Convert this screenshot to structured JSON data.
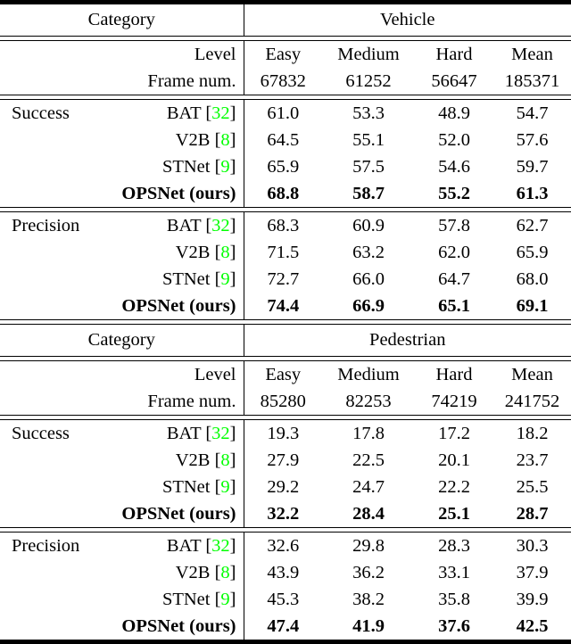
{
  "table": {
    "caption_colors": {
      "citation_green": "#00FF00",
      "text": "#000000"
    },
    "column_divider": "|",
    "sections": [
      {
        "id": "vehicle",
        "category_label": "Category",
        "category_value": "Vehicle",
        "level_label": "Level",
        "frame_label": "Frame num.",
        "levels": [
          "Easy",
          "Medium",
          "Hard",
          "Mean"
        ],
        "frame_nums": [
          "67832",
          "61252",
          "56647",
          "185371"
        ],
        "groups": [
          {
            "metric": "Success",
            "rows": [
              {
                "method": "BAT",
                "cite": "32",
                "bold": false,
                "values": [
                  "61.0",
                  "53.3",
                  "48.9",
                  "54.7"
                ]
              },
              {
                "method": "V2B",
                "cite": "8",
                "bold": false,
                "values": [
                  "64.5",
                  "55.1",
                  "52.0",
                  "57.6"
                ]
              },
              {
                "method": "STNet",
                "cite": "9",
                "bold": false,
                "values": [
                  "65.9",
                  "57.5",
                  "54.6",
                  "59.7"
                ]
              },
              {
                "method": "OPSNet (ours)",
                "cite": "",
                "bold": true,
                "values": [
                  "68.8",
                  "58.7",
                  "55.2",
                  "61.3"
                ]
              }
            ]
          },
          {
            "metric": "Precision",
            "rows": [
              {
                "method": "BAT",
                "cite": "32",
                "bold": false,
                "values": [
                  "68.3",
                  "60.9",
                  "57.8",
                  "62.7"
                ]
              },
              {
                "method": "V2B",
                "cite": "8",
                "bold": false,
                "values": [
                  "71.5",
                  "63.2",
                  "62.0",
                  "65.9"
                ]
              },
              {
                "method": "STNet",
                "cite": "9",
                "bold": false,
                "values": [
                  "72.7",
                  "66.0",
                  "64.7",
                  "68.0"
                ]
              },
              {
                "method": "OPSNet (ours)",
                "cite": "",
                "bold": true,
                "values": [
                  "74.4",
                  "66.9",
                  "65.1",
                  "69.1"
                ]
              }
            ]
          }
        ]
      },
      {
        "id": "pedestrian",
        "category_label": "Category",
        "category_value": "Pedestrian",
        "level_label": "Level",
        "frame_label": "Frame num.",
        "levels": [
          "Easy",
          "Medium",
          "Hard",
          "Mean"
        ],
        "frame_nums": [
          "85280",
          "82253",
          "74219",
          "241752"
        ],
        "groups": [
          {
            "metric": "Success",
            "rows": [
              {
                "method": "BAT",
                "cite": "32",
                "bold": false,
                "values": [
                  "19.3",
                  "17.8",
                  "17.2",
                  "18.2"
                ]
              },
              {
                "method": "V2B",
                "cite": "8",
                "bold": false,
                "values": [
                  "27.9",
                  "22.5",
                  "20.1",
                  "23.7"
                ]
              },
              {
                "method": "STNet",
                "cite": "9",
                "bold": false,
                "values": [
                  "29.2",
                  "24.7",
                  "22.2",
                  "25.5"
                ]
              },
              {
                "method": "OPSNet (ours)",
                "cite": "",
                "bold": true,
                "values": [
                  "32.2",
                  "28.4",
                  "25.1",
                  "28.7"
                ]
              }
            ]
          },
          {
            "metric": "Precision",
            "rows": [
              {
                "method": "BAT",
                "cite": "32",
                "bold": false,
                "values": [
                  "32.6",
                  "29.8",
                  "28.3",
                  "30.3"
                ]
              },
              {
                "method": "V2B",
                "cite": "8",
                "bold": false,
                "values": [
                  "43.9",
                  "36.2",
                  "33.1",
                  "37.9"
                ]
              },
              {
                "method": "STNet",
                "cite": "9",
                "bold": false,
                "values": [
                  "45.3",
                  "38.2",
                  "35.8",
                  "39.9"
                ]
              },
              {
                "method": "OPSNet (ours)",
                "cite": "",
                "bold": true,
                "values": [
                  "47.4",
                  "41.9",
                  "37.6",
                  "42.5"
                ]
              }
            ]
          }
        ]
      }
    ]
  }
}
